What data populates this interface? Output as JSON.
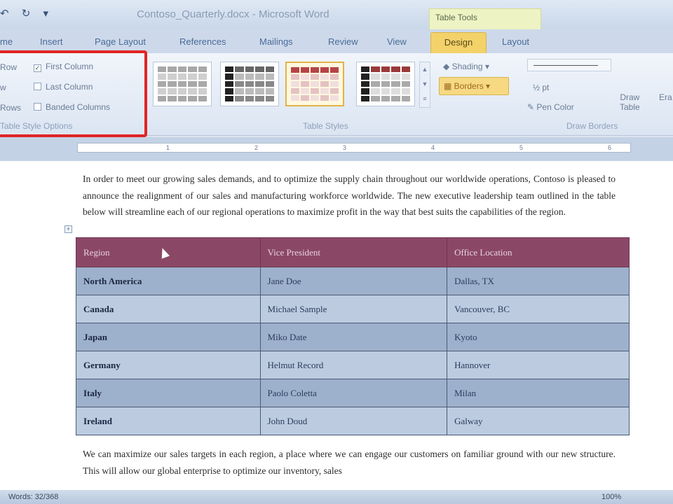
{
  "title_bar": {
    "title": "Contoso_Quarterly.docx - Microsoft Word",
    "contextual_group": "Table Tools",
    "quick_access": [
      "↶",
      "↻",
      "▾"
    ]
  },
  "tabs": {
    "home": "me",
    "insert": "Insert",
    "page_layout": "Page Layout",
    "references": "References",
    "mailings": "Mailings",
    "review": "Review",
    "view": "View",
    "design": "Design",
    "layout": "Layout"
  },
  "style_options": {
    "header_row": "Row",
    "total_row": "w",
    "banded_rows": "Rows",
    "first_column": "First Column",
    "last_column": "Last Column",
    "banded_columns": "Banded Columns",
    "first_column_checked": true,
    "last_column_checked": false,
    "banded_columns_checked": false,
    "group_label": "Table Style Options"
  },
  "table_styles": {
    "group_label": "Table Styles"
  },
  "shading": {
    "label": "Shading",
    "arrow": "▾"
  },
  "borders": {
    "label": "Borders",
    "arrow": "▾"
  },
  "draw_borders": {
    "pen_weight": "½ pt",
    "pen_color": "Pen Color",
    "draw_table_line1": "Draw",
    "draw_table_line2": "Table",
    "eraser": "Era",
    "group_label": "Draw Borders"
  },
  "document": {
    "intro": "In order to meet our growing  sales demands, and to optimize the supply chain throughout our worldwide operations, Contoso is pleased to announce the realignment of our sales and manufacturing workforce worldwide.  The new executive leadership team outlined in the table below will streamline each of our regional operations to maximize profit in the way that best suits the capabilities of the region.",
    "outro": "We can maximize our sales targets in each region, a place where we can engage our customers on familiar ground with our new structure. This will allow our global enterprise to optimize our inventory, sales",
    "table": {
      "headers": [
        "Region",
        "Vice President",
        "Office Location"
      ],
      "rows": [
        [
          "North America",
          "Jane Doe",
          "Dallas, TX"
        ],
        [
          "Canada",
          "Michael Sample",
          "Vancouver, BC"
        ],
        [
          "Japan",
          "Miko Date",
          "Kyoto"
        ],
        [
          "Germany",
          "Helmut Record",
          "Hannover"
        ],
        [
          "Italy",
          "Paolo Coletta",
          "Milan"
        ],
        [
          "Ireland",
          "John Doud",
          "Galway"
        ]
      ]
    }
  },
  "status_bar": {
    "words": "Words: 32/368",
    "zoom": "100%"
  },
  "colors": {
    "header_row": "#8b4866",
    "band_dark": "#9db1cc",
    "band_light": "#bccbe0",
    "highlight_box": "#e02525"
  }
}
